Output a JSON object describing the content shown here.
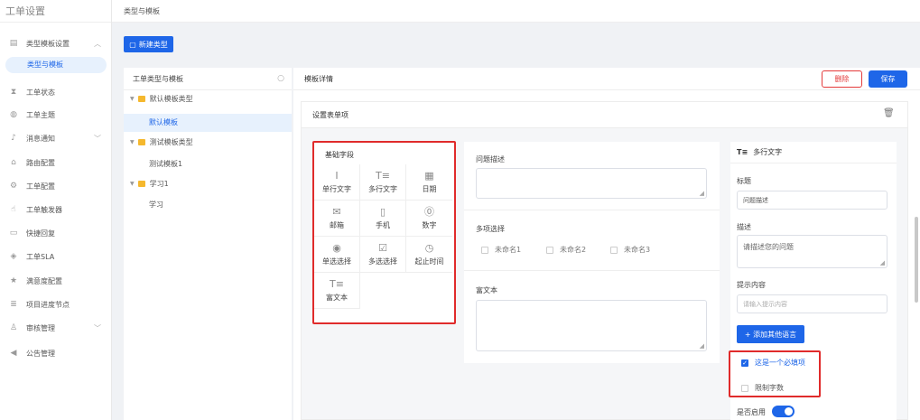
{
  "app": {
    "title": "工单设置"
  },
  "breadcrumb": "类型与模板",
  "sidebar": {
    "items": [
      {
        "label": "类型模板设置",
        "icon": "template-icon",
        "expanded": true
      },
      {
        "label": "类型与模板",
        "sub": true,
        "active": true
      },
      {
        "label": "工单状态",
        "icon": "hourglass-icon"
      },
      {
        "label": "工单主题",
        "icon": "palette-icon"
      },
      {
        "label": "消息通知",
        "icon": "bell-icon",
        "has_chevron": true
      },
      {
        "label": "路由配置",
        "icon": "route-icon"
      },
      {
        "label": "工单配置",
        "icon": "gear-icon"
      },
      {
        "label": "工单触发器",
        "icon": "trigger-icon"
      },
      {
        "label": "快捷回复",
        "icon": "reply-icon"
      },
      {
        "label": "工单SLA",
        "icon": "shield-icon"
      },
      {
        "label": "满意度配置",
        "icon": "star-icon"
      },
      {
        "label": "项目进度节点",
        "icon": "list-icon"
      },
      {
        "label": "审核管理",
        "icon": "user-check-icon",
        "has_chevron": true
      },
      {
        "label": "公告管理",
        "icon": "megaphone-icon"
      }
    ]
  },
  "toolbar": {
    "new_type_label": "新建类型"
  },
  "left_panel": {
    "title": "工单类型与模板",
    "tree": [
      {
        "label": "默认模板类型",
        "level": 0
      },
      {
        "label": "默认模板",
        "level": 1,
        "selected": true
      },
      {
        "label": "测试模板类型",
        "level": 0
      },
      {
        "label": "测试模板1",
        "level": 1
      },
      {
        "label": "学习1",
        "level": 0
      },
      {
        "label": "学习",
        "level": 1
      }
    ]
  },
  "right_panel": {
    "title": "模板详情",
    "delete_label": "删除",
    "save_label": "保存",
    "form_section_title": "设置表单项"
  },
  "field_palette": {
    "title": "基础字段",
    "items": [
      {
        "label": "单行文字",
        "icon": "single-line-text-icon",
        "glyph": "Ⅰ"
      },
      {
        "label": "多行文字",
        "icon": "multi-line-text-icon",
        "glyph": "T≡"
      },
      {
        "label": "日期",
        "icon": "calendar-icon",
        "glyph": "▦"
      },
      {
        "label": "邮箱",
        "icon": "mail-icon",
        "glyph": "✉"
      },
      {
        "label": "手机",
        "icon": "phone-icon",
        "glyph": "▯"
      },
      {
        "label": "数字",
        "icon": "number-icon",
        "glyph": "⓪"
      },
      {
        "label": "单选选择",
        "icon": "radio-icon",
        "glyph": "◉"
      },
      {
        "label": "多选选择",
        "icon": "checkbox-icon",
        "glyph": "☑"
      },
      {
        "label": "起止时间",
        "icon": "clock-icon",
        "glyph": "◷"
      },
      {
        "label": "富文本",
        "icon": "rich-text-icon",
        "glyph": "T≡"
      }
    ]
  },
  "form_preview": {
    "question_label": "问题描述",
    "multi_select_label": "多项选择",
    "options": [
      "未命名1",
      "未命名2",
      "未命名3"
    ],
    "rich_text_label": "富文本"
  },
  "properties": {
    "field_type": "多行文字",
    "title_label": "标题",
    "title_value": "问题描述",
    "desc_label": "描述",
    "desc_value": "请描述您的问题",
    "hint_label": "提示内容",
    "hint_placeholder": "请输入提示内容",
    "add_lang_label": "+ 添加其他语言",
    "required_label": "这是一个必填项",
    "required_checked": true,
    "limit_label": "限制字数",
    "limit_checked": false,
    "enabled_label": "是否启用",
    "enabled": true
  },
  "colors": {
    "primary": "#1e66e8",
    "danger": "#e43b3b",
    "highlight": "#e02b2b",
    "folder": "#f5b82e"
  }
}
